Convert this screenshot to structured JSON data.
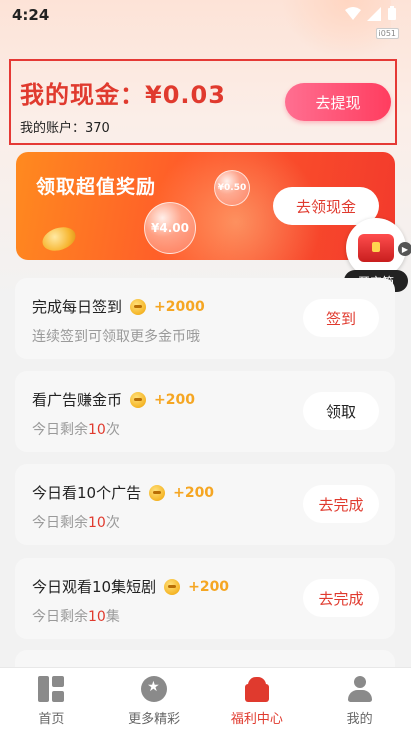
{
  "status_bar": {
    "time": "4:24",
    "badge": "i051"
  },
  "cash_card": {
    "title_prefix": "我的现金：",
    "amount": "¥0.03",
    "account_label": "我的账户：",
    "account_value": "370",
    "withdraw_label": "去提现"
  },
  "banner": {
    "title": "领取超值奖励",
    "bubble_small": "¥0.50",
    "bubble_big": "¥4.00",
    "button_label": "去领现金"
  },
  "treasure": {
    "label": "开宝箱"
  },
  "tasks": [
    {
      "name": "完成每日签到",
      "reward": "+2000",
      "sub_prefix": "连续签到可领取更多金币哦",
      "sub_count": "",
      "sub_suffix": "",
      "button": "签到"
    },
    {
      "name": "看广告赚金币",
      "reward": "+200",
      "sub_prefix": "今日剩余",
      "sub_count": "10",
      "sub_suffix": "次",
      "button": "领取"
    },
    {
      "name": "今日看10个广告",
      "reward": "+200",
      "sub_prefix": "今日剩余",
      "sub_count": "10",
      "sub_suffix": "次",
      "button": "去完成"
    },
    {
      "name": "今日观看10集短剧",
      "reward": "+200",
      "sub_prefix": "今日剩余",
      "sub_count": "10",
      "sub_suffix": "集",
      "button": "去完成"
    }
  ],
  "bottom_nav": [
    {
      "label": "首页",
      "icon": "home-icon"
    },
    {
      "label": "更多精彩",
      "icon": "star-badge-icon"
    },
    {
      "label": "福利中心",
      "icon": "gift-icon",
      "active": true
    },
    {
      "label": "我的",
      "icon": "profile-icon"
    }
  ],
  "colors": {
    "accent": "#e03a2e",
    "reward": "#f5a623"
  }
}
